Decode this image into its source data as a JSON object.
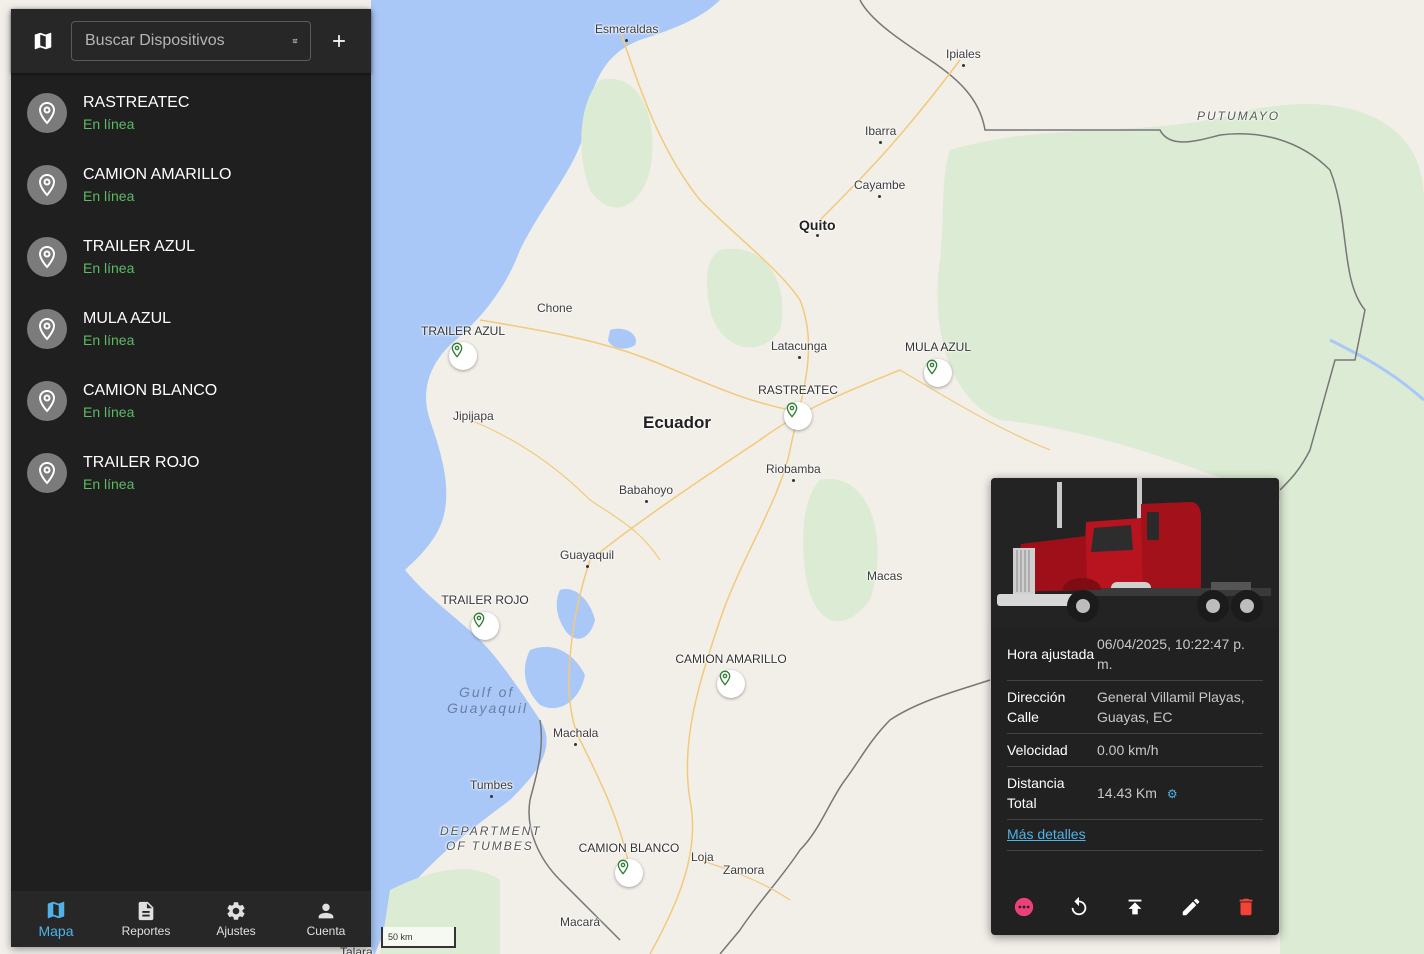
{
  "search": {
    "placeholder": "Buscar Dispositivos"
  },
  "devices": [
    {
      "name": "RASTREATEC",
      "status": "En línea"
    },
    {
      "name": "CAMION AMARILLO",
      "status": "En línea"
    },
    {
      "name": "TRAILER AZUL",
      "status": "En línea"
    },
    {
      "name": "MULA AZUL",
      "status": "En línea"
    },
    {
      "name": "CAMION BLANCO",
      "status": "En línea"
    },
    {
      "name": "TRAILER ROJO",
      "status": "En línea"
    }
  ],
  "nav": [
    {
      "label": "Mapa",
      "icon": "map-icon",
      "active": true
    },
    {
      "label": "Reportes",
      "icon": "document-icon"
    },
    {
      "label": "Ajustes",
      "icon": "gear-icon"
    },
    {
      "label": "Cuenta",
      "icon": "person-icon"
    }
  ],
  "map": {
    "places": {
      "esmeraldas": "Esmeraldas",
      "ipiales": "Ipiales",
      "putumayo": "PUTUMAYO",
      "ibarra": "Ibarra",
      "cayambe": "Cayambe",
      "quito": "Quito",
      "chone": "Chone",
      "latacunga": "Latacunga",
      "ecuador": "Ecuador",
      "jipijapa": "Jipijapa",
      "riobamba": "Riobamba",
      "babahoyo": "Babahoyo",
      "guayaquil": "Guayaquil",
      "macas": "Macas",
      "gulf1": "Gulf of",
      "gulf2": "Guayaquil",
      "machala": "Machala",
      "tumbes": "Tumbes",
      "dept1": "DEPARTMENT",
      "dept2": "OF TUMBES",
      "loja": "Loja",
      "zamora": "Zamora",
      "macara": "Macará",
      "talara": "Talara"
    },
    "markers": {
      "trailer_azul": "TRAILER AZUL",
      "rastreatec": "RASTREATEC",
      "mula_azul": "MULA AZUL",
      "trailer_rojo": "TRAILER ROJO",
      "camion_amarillo": "CAMION AMARILLO",
      "camion_blanco": "CAMION BLANCO"
    },
    "scale": "50 km"
  },
  "popup": {
    "rows": [
      {
        "key": "Hora ajustada",
        "value": "06/04/2025, 10:22:47 p. m."
      },
      {
        "key": "Dirección Calle",
        "value": "General Villamil Playas, Guayas, EC"
      },
      {
        "key": "Velocidad",
        "value": "0.00 km/h"
      },
      {
        "key": "Distancia Total",
        "value": "14.43 Km"
      }
    ],
    "more_link": "Más detalles"
  },
  "colors": {
    "online": "#5dbb63",
    "accent": "#4fb3e8",
    "delete": "#f44336",
    "more": "#ec407a",
    "marker": "#2e7d32"
  }
}
